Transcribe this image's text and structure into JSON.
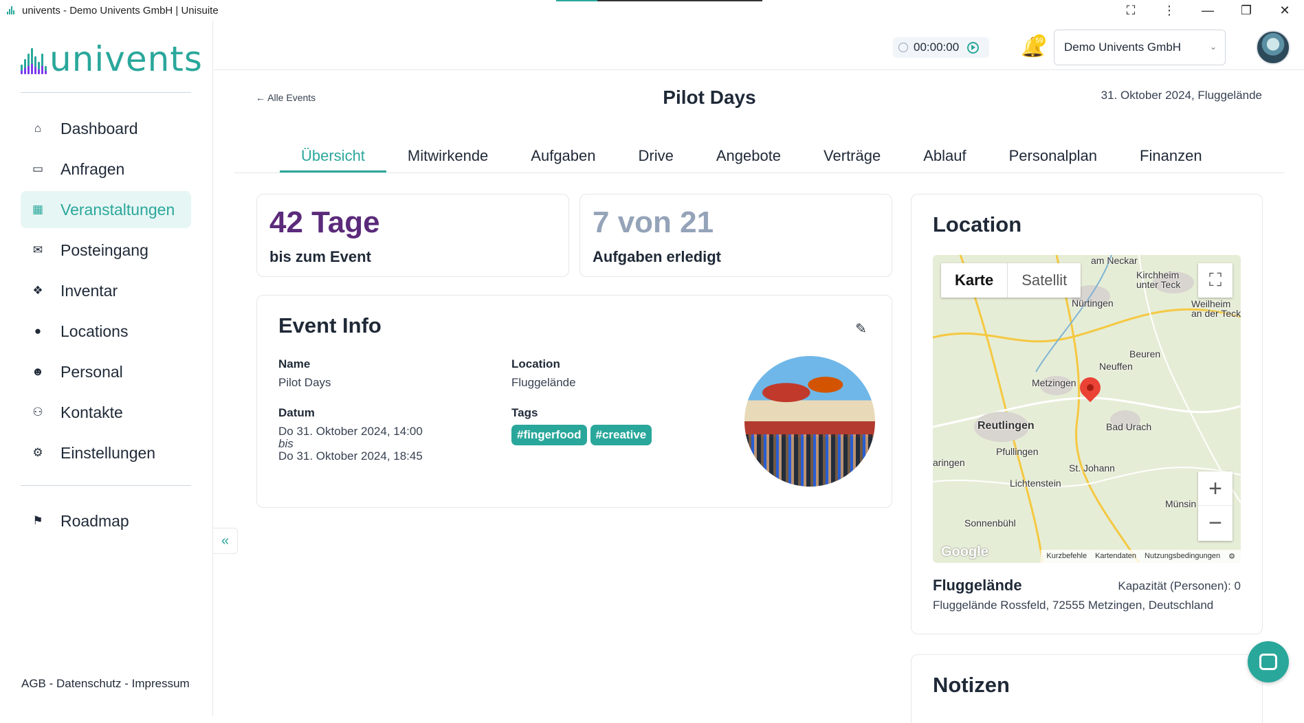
{
  "window": {
    "title": "univents - Demo Univents GmbH | Unisuite",
    "controls": {
      "extension": "⛶",
      "menu": "⋮",
      "minimize": "—",
      "restore": "❐",
      "close": "✕"
    }
  },
  "brand": {
    "logo_text": "univents",
    "accent": "#2aa79b",
    "purple": "#5b2a7a"
  },
  "sidebar": {
    "items": [
      {
        "label": "Dashboard",
        "icon": "home-icon",
        "glyph": "⌂"
      },
      {
        "label": "Anfragen",
        "icon": "inbox-icon",
        "glyph": "▭"
      },
      {
        "label": "Veranstaltungen",
        "icon": "calendar-icon",
        "glyph": "▦",
        "active": true
      },
      {
        "label": "Posteingang",
        "icon": "envelope-icon",
        "glyph": "✉"
      },
      {
        "label": "Inventar",
        "icon": "dropbox-icon",
        "glyph": "❖"
      },
      {
        "label": "Locations",
        "icon": "map-pin-icon",
        "glyph": "●"
      },
      {
        "label": "Personal",
        "icon": "users-icon",
        "glyph": "☻"
      },
      {
        "label": "Kontakte",
        "icon": "handshake-icon",
        "glyph": "⚇"
      },
      {
        "label": "Einstellungen",
        "icon": "gear-icon",
        "glyph": "⚙"
      }
    ],
    "roadmap": {
      "label": "Roadmap",
      "icon": "signpost-icon",
      "glyph": "⚑"
    },
    "footer": "AGB - Datenschutz - Impressum",
    "collapse_glyph": "«"
  },
  "header": {
    "timer": "00:00:00",
    "notifications_count": "59",
    "organization": "Demo Univents GmbH"
  },
  "page": {
    "back_link": "← Alle Events",
    "title": "Pilot Days",
    "date_location": "31. Oktober 2024, Fluggelände"
  },
  "tabs": [
    {
      "label": "Übersicht",
      "active": true
    },
    {
      "label": "Mitwirkende"
    },
    {
      "label": "Aufgaben"
    },
    {
      "label": "Drive"
    },
    {
      "label": "Angebote"
    },
    {
      "label": "Verträge"
    },
    {
      "label": "Ablauf"
    },
    {
      "label": "Personalplan"
    },
    {
      "label": "Finanzen"
    }
  ],
  "stats": {
    "days": {
      "value": "42 Tage",
      "label": "bis zum Event"
    },
    "tasks": {
      "value": "7 von 21",
      "label": "Aufgaben erledigt",
      "done": 7,
      "total": 21
    }
  },
  "event_info": {
    "title": "Event Info",
    "name_label": "Name",
    "name": "Pilot Days",
    "location_label": "Location",
    "location": "Fluggelände",
    "date_label": "Datum",
    "start": "Do 31. Oktober 2024, 14:00",
    "separator": "bis",
    "end": "Do 31. Oktober 2024, 18:45",
    "tags_label": "Tags",
    "tags": [
      "#fingerfood",
      "#creative"
    ]
  },
  "location_card": {
    "title": "Location",
    "map": {
      "type_map": "Karte",
      "type_satellite": "Satellit",
      "places": [
        {
          "name": "am Neckar"
        },
        {
          "name": "Kirchheim\nunter Teck"
        },
        {
          "name": "Nürtingen"
        },
        {
          "name": "Weilheim\nan der Teck"
        },
        {
          "name": "Beuren"
        },
        {
          "name": "Neuffen"
        },
        {
          "name": "Metzingen"
        },
        {
          "name": "Reutlingen",
          "big": true
        },
        {
          "name": "Bad Urach"
        },
        {
          "name": "Pfullingen"
        },
        {
          "name": "St. Johann"
        },
        {
          "name": "Lichtenstein"
        },
        {
          "name": "Münsin"
        },
        {
          "name": "Sonnenbühl"
        },
        {
          "name": "aringen"
        }
      ],
      "google": "Google",
      "links": [
        "Kurzbefehle",
        "Kartendaten",
        "Nutzungsbedingungen"
      ]
    },
    "name": "Fluggelände",
    "capacity": "Kapazität (Personen): 0",
    "address": "Fluggelände Rossfeld, 72555 Metzingen, Deutschland"
  },
  "notes": {
    "title": "Notizen"
  }
}
